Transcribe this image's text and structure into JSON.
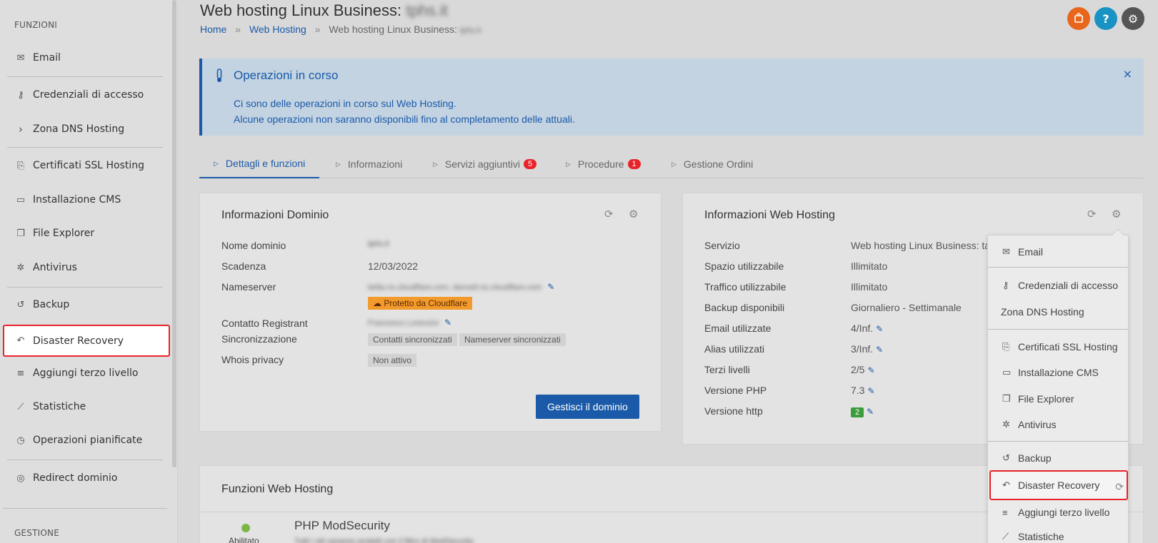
{
  "sidebar": {
    "section_functions": "FUNZIONI",
    "section_management": "GESTIONE",
    "items": [
      {
        "label": "Email",
        "icon": "mail-icon"
      },
      {
        "label": "Credenziali di accesso",
        "icon": "key-icon"
      },
      {
        "label": "Zona DNS Hosting",
        "icon": "chevron-right-icon"
      },
      {
        "label": "Certificati SSL Hosting",
        "icon": "certificate-icon"
      },
      {
        "label": "Installazione CMS",
        "icon": "window-icon"
      },
      {
        "label": "File Explorer",
        "icon": "folders-icon"
      },
      {
        "label": "Antivirus",
        "icon": "bug-icon"
      },
      {
        "label": "Backup",
        "icon": "history-icon"
      },
      {
        "label": "Disaster Recovery",
        "icon": "undo-icon"
      },
      {
        "label": "Aggiungi terzo livello",
        "icon": "list-icon"
      },
      {
        "label": "Statistiche",
        "icon": "chart-icon"
      },
      {
        "label": "Operazioni pianificate",
        "icon": "clock-icon"
      },
      {
        "label": "Redirect dominio",
        "icon": "compass-icon"
      }
    ]
  },
  "header": {
    "title": "Web hosting Linux Business:",
    "title_redacted": "tphs.it",
    "breadcrumb": {
      "home": "Home",
      "sep": "»",
      "web_hosting": "Web Hosting",
      "current": "Web hosting Linux Business:",
      "current_redacted": "tphs.it"
    }
  },
  "top_buttons": {
    "cart_color": "#e8661c",
    "help_color": "#1993c4",
    "settings_color": "#555555",
    "help_label": "?"
  },
  "alert": {
    "title": "Operazioni in corso",
    "line1": "Ci sono delle operazioni in corso sul Web Hosting.",
    "line2": "Alcune operazioni non saranno disponibili fino al completamento delle attuali.",
    "close": "×"
  },
  "tabs": [
    {
      "label": "Dettagli e funzioni",
      "badge": null
    },
    {
      "label": "Informazioni",
      "badge": null
    },
    {
      "label": "Servizi aggiuntivi",
      "badge": "5"
    },
    {
      "label": "Procedure",
      "badge": "1"
    },
    {
      "label": "Gestione Ordini",
      "badge": null
    }
  ],
  "domain_panel": {
    "title": "Informazioni Dominio",
    "labels": {
      "name": "Nome dominio",
      "expiry": "Scadenza",
      "nameserver": "Nameserver",
      "registrant": "Contatto Registrant",
      "sync": "Sincronizzazione",
      "whois": "Whois privacy"
    },
    "values": {
      "name": "tphs.it",
      "expiry": "12/03/2022",
      "nameserver": "bella.ns.cloudflare.com, dannell.ns.cloudflare.com",
      "cloudflare": "Protetto da Cloudflare",
      "registrant": "Francesco Lorenzini",
      "sync_contacts": "Contatti sincronizzati",
      "sync_ns": "Nameserver sincronizzati",
      "whois": "Non attivo"
    },
    "button": "Gestisci il dominio"
  },
  "hosting_panel": {
    "title": "Informazioni Web Hosting",
    "rows": [
      {
        "label": "Servizio",
        "value": "Web hosting Linux Business: ta"
      },
      {
        "label": "Spazio utilizzabile",
        "value": "Illimitato"
      },
      {
        "label": "Traffico utilizzabile",
        "value": "Illimitato"
      },
      {
        "label": "Backup disponibili",
        "value": "Giornaliero - Settimanale"
      },
      {
        "label": "Email utilizzate",
        "value": "4/Inf."
      },
      {
        "label": "Alias utilizzati",
        "value": "3/Inf."
      },
      {
        "label": "Terzi livelli",
        "value": "2/5"
      },
      {
        "label": "Versione PHP",
        "value": "7.3"
      },
      {
        "label": "Versione http",
        "value": "2"
      }
    ]
  },
  "functions_panel": {
    "title": "Funzioni Web Hosting",
    "item_title": "PHP ModSecurity",
    "status": "Abilitato",
    "desc": "Tutti i siti saranno protetti con il filtro di ModSecurity"
  },
  "dropdown": {
    "items": [
      {
        "label": "Email",
        "icon": "mail-icon"
      },
      {
        "label": "Credenziali di accesso",
        "icon": "key-icon"
      },
      {
        "label": "Zona DNS Hosting",
        "icon": ""
      },
      {
        "label": "Certificati SSL Hosting",
        "icon": "certificate-icon"
      },
      {
        "label": "Installazione CMS",
        "icon": "window-icon"
      },
      {
        "label": "File Explorer",
        "icon": "folders-icon"
      },
      {
        "label": "Antivirus",
        "icon": "bug-icon"
      },
      {
        "label": "Backup",
        "icon": "history-icon"
      },
      {
        "label": "Disaster Recovery",
        "icon": "undo-icon"
      },
      {
        "label": "Aggiungi terzo livello",
        "icon": "list-icon"
      },
      {
        "label": "Statistiche",
        "icon": "chart-icon"
      }
    ]
  }
}
